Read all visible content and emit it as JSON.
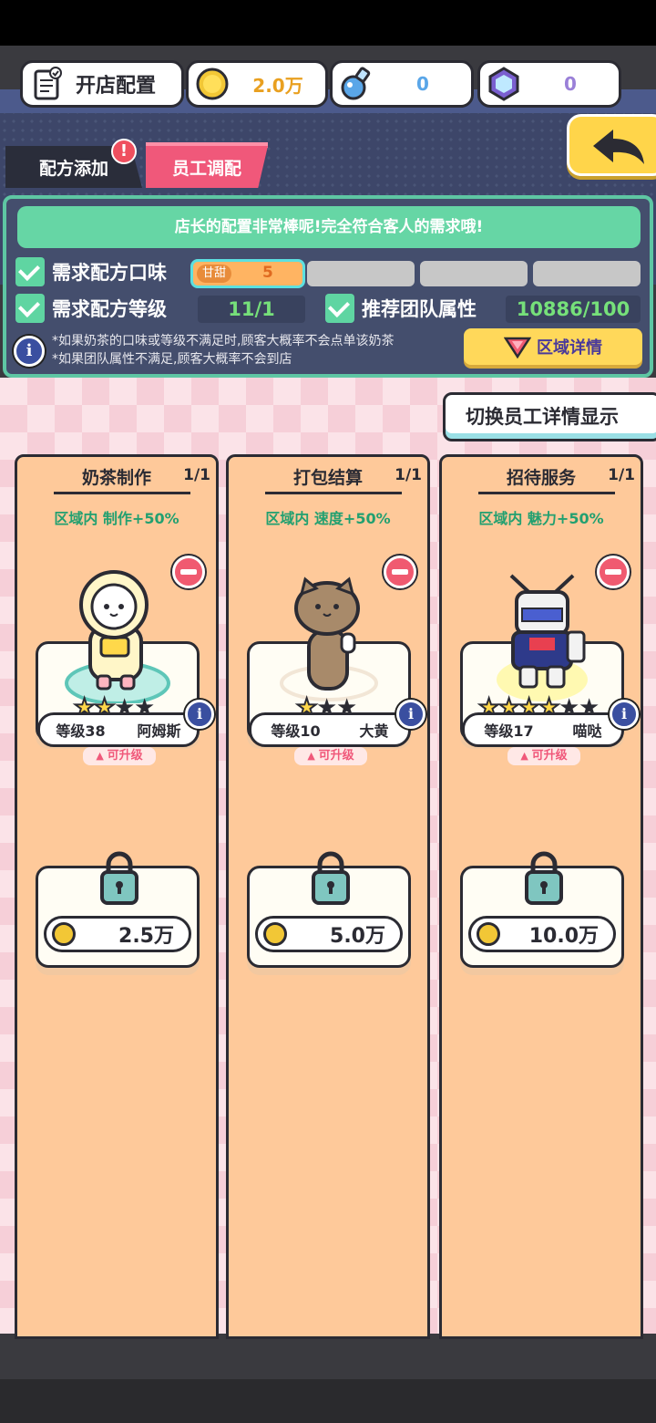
{
  "header": {
    "shop_config_label": "开店配置",
    "coins": "2.0万",
    "potions": "0",
    "gems": "0"
  },
  "tabs": {
    "recipe": "配方添加",
    "staff": "员工调配",
    "alert": "!"
  },
  "info_panel": {
    "banner": "店长的配置非常棒呢!完全符合客人的需求哦!",
    "req_taste_label": "需求配方口味",
    "taste_tag": "甘甜",
    "taste_value": "5",
    "req_level_label": "需求配方等级",
    "level_value": "11/1",
    "team_label": "推荐团队属性",
    "team_value": "10886/100",
    "note_1": "*如果奶茶的口味或等级不满足时,顾客大概率不会点单该奶茶",
    "note_2": "*如果团队属性不满足,顾客大概率不会到店",
    "zone_detail_button": "区域详情"
  },
  "toggle_staff_detail": "切换员工详情显示",
  "columns": [
    {
      "title": "奶茶制作",
      "count": "1/1",
      "bonus": "区域内 制作+50%",
      "staff": {
        "level": "等级38",
        "name": "阿姆斯",
        "stars": 2,
        "max_stars": 4,
        "upgrade": "可升级"
      },
      "locked_price": "2.5万"
    },
    {
      "title": "打包结算",
      "count": "1/1",
      "bonus": "区域内 速度+50%",
      "staff": {
        "level": "等级10",
        "name": "大黄",
        "stars": 1,
        "max_stars": 3,
        "upgrade": "可升级"
      },
      "locked_price": "5.0万"
    },
    {
      "title": "招待服务",
      "count": "1/1",
      "bonus": "区域内 魅力+50%",
      "staff": {
        "level": "等级17",
        "name": "喵哒",
        "stars": 4,
        "max_stars": 6,
        "upgrade": "可升级"
      },
      "locked_price": "10.0万"
    }
  ],
  "colors": {
    "accent_pink": "#f0587a",
    "accent_green": "#5fd5a2",
    "coin_gold": "#f2c736",
    "panel_bg": "#444e6d"
  }
}
